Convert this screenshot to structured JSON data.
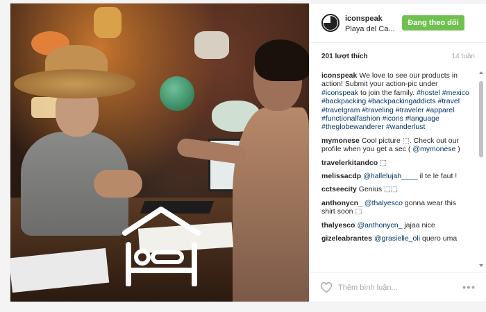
{
  "header": {
    "username": "iconspeak",
    "location": "Playa del Ca...",
    "follow_label": "Đang theo dõi",
    "avatar_icon": "pie-chart-icon"
  },
  "stats": {
    "likes": "201 lượt thích",
    "age": "14 tuần"
  },
  "caption": {
    "author": "iconspeak",
    "text": "We love to see our products in action! Submit your action-pic under",
    "tag_main": "#iconspeak",
    "text_after": "to join the family.",
    "hashtags": "#hostel #mexico #backpacking #backpackingaddicts #travel #travelgram #traveling #traveler #apparel #functionalfashion #icons #language #theglobewanderer #wanderlust"
  },
  "comments": [
    {
      "author": "mymonese",
      "text": "Cool picture ⬚. Check out our profile when you get a sec (",
      "mention": "@mymonese",
      "text_after": ")"
    },
    {
      "author": "travelerkitandco",
      "text": "⬚",
      "mention": "",
      "text_after": ""
    },
    {
      "author": "melissacdp",
      "text": "",
      "mention": "@hallelujah____",
      "text_after": "il te le faut !"
    },
    {
      "author": "cctseecity",
      "text": "Genius ⬚⬚",
      "mention": "",
      "text_after": ""
    },
    {
      "author": "anthonycn_",
      "text": "",
      "mention": "@thalyesco",
      "text_after": "gonna wear this shirt soon ⬚"
    },
    {
      "author": "thalyesco",
      "text": "",
      "mention": "@anthonycn_",
      "text_after": "jajaa nice"
    },
    {
      "author": "gizeleabrantes",
      "text": "",
      "mention": "@grasielle_oli",
      "text_after": "quero uma"
    }
  ],
  "footer": {
    "comment_placeholder": "Thêm bình luận...",
    "heart_icon": "heart-icon",
    "more_icon": "more-options-icon"
  },
  "photo": {
    "overlay_icon": "hostel-bed-icon"
  },
  "colors": {
    "follow_button": "#70c050",
    "link": "#003569",
    "muted": "#a5a7aa"
  }
}
